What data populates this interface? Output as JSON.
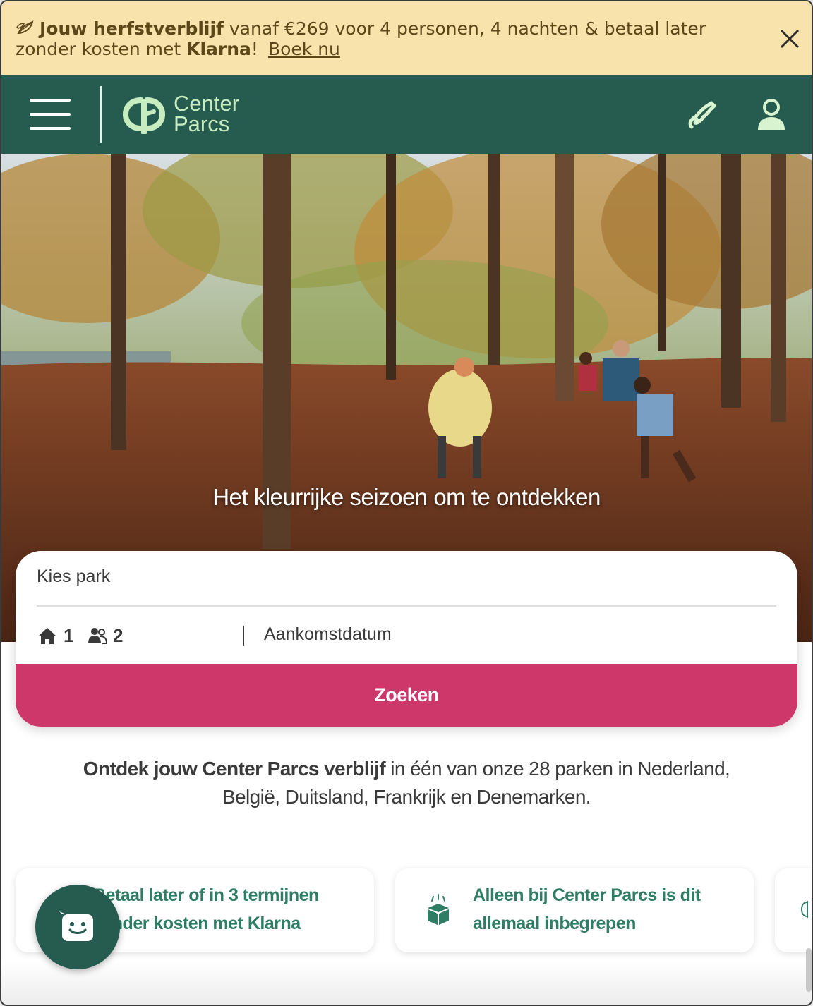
{
  "promo": {
    "title_bold": "Jouw herfstverblijf",
    "text_main": " vanaf €269 voor 4 personen, 4 nachten & betaal later zonder kosten met ",
    "text_klarna": "Klarna",
    "text_end": "!",
    "link": "Boek nu"
  },
  "header": {
    "logo_line1": "Center",
    "logo_line2": "Parcs"
  },
  "hero": {
    "caption": "Het kleurrijke seizoen om te ontdekken"
  },
  "search": {
    "park_placeholder": "Kies park",
    "accommodations": "1",
    "persons": "2",
    "arrival_placeholder": "Aankomstdatum",
    "button": "Zoeken"
  },
  "intro": {
    "bold": "Ontdek jouw Center Parcs verblijf",
    "rest": " in één van onze 28 parken in Nederland, België, Duitsland, Frankrijk en Denemarken."
  },
  "usps": [
    {
      "text": "Betaal later of in 3 termijnen zonder kosten met Klarna"
    },
    {
      "text": "Alleen bij Center Parcs is dit allemaal inbegrepen"
    }
  ],
  "colors": {
    "brand_green": "#255c4f",
    "logo_mint": "#c7ecc0",
    "promo_bg": "#f8e3ac",
    "cta_pink": "#cd376a",
    "usp_green": "#2e7d64"
  },
  "icons": [
    "leaf-icon",
    "close-icon",
    "hamburger-icon",
    "center-parcs-logo",
    "phone-icon",
    "user-icon",
    "house-icon",
    "people-icon",
    "gift-box-icon",
    "chat-icon"
  ]
}
